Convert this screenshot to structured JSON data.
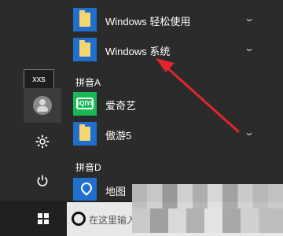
{
  "sidebar": {
    "user_name": "xxs"
  },
  "app_list": {
    "items": [
      {
        "label": "Windows 轻松使用",
        "icon": "folder-icon",
        "expandable": true
      },
      {
        "label": "Windows 系统",
        "icon": "folder-icon",
        "expandable": true
      },
      {
        "label": "爱奇艺",
        "icon": "iqiyi-icon",
        "expandable": false
      },
      {
        "label": "傲游5",
        "icon": "folder-icon",
        "expandable": true
      },
      {
        "label": "地图",
        "icon": "maps-icon",
        "expandable": false
      }
    ],
    "groups": [
      {
        "label": "拼音A"
      },
      {
        "label": "拼音D"
      }
    ]
  },
  "taskbar": {
    "search_placeholder": "在这里输入"
  },
  "colors": {
    "tile_blue": "#1f6fcf",
    "iqiyi_green": "#19b955",
    "arrow_red": "#e0262a"
  }
}
